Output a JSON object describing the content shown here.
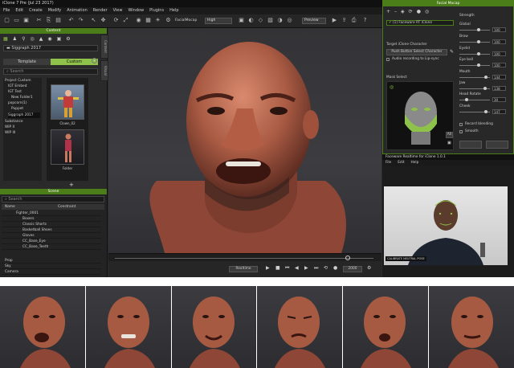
{
  "app": {
    "title": "iClone 7 Pre (Jul 23 2017)"
  },
  "menu": [
    "File",
    "Edit",
    "Create",
    "Modify",
    "Animation",
    "Render",
    "View",
    "Window",
    "Plugins",
    "Help"
  ],
  "toolbar": {
    "preset_label": "FacialMocap",
    "quality": "High",
    "preview": "Preview"
  },
  "content": {
    "title": "Content",
    "path": "Siggraph 2017",
    "tabs": [
      "Template",
      "Custom"
    ],
    "search_placeholder": "Search",
    "tree": [
      "Project Custom",
      "IGT Embed",
      "IGT Test",
      "New Folder1",
      "popcorn(1)",
      "Puppet",
      "Siggraph 2017",
      "Substance",
      "WIP II",
      "WIP III"
    ],
    "items": [
      {
        "label": "Clown_02"
      },
      {
        "label": "Folder"
      }
    ],
    "side_tabs": [
      "Content",
      "Visual"
    ]
  },
  "scene": {
    "title": "Scene",
    "search_placeholder": "Search",
    "columns": [
      "Name",
      "Constraint"
    ],
    "rows": [
      "Fighter_0001",
      "Boxers",
      "Classic Shorts",
      "Basketball Shoes",
      "Gloves",
      "CC_Base_Eye",
      "CC_Base_Teeth"
    ],
    "footer_rows": [
      "Prop",
      "Sky",
      "Camera"
    ]
  },
  "playback": {
    "realtime": "Realtime",
    "frame": "2000"
  },
  "facial_mocap": {
    "title": "Facial Mocap",
    "device_entry": "(1) Faceware RT iClone",
    "target_label": "Target iClone Character",
    "pick_button": "Push Button Select Character",
    "audio_label": "Audio recording to Lip-sync",
    "mask_label": "Mask Select",
    "all_button": "All",
    "strength_title": "Strength",
    "sliders": [
      {
        "label": "Global",
        "value": "100",
        "level": 0.65
      },
      {
        "label": "Brow",
        "value": "100",
        "level": 0.65
      },
      {
        "label": "Eyelid",
        "value": "100",
        "level": 0.65
      },
      {
        "label": "Eye ball",
        "value": "100",
        "level": 0.65
      },
      {
        "label": "Mouth",
        "value": "144",
        "level": 0.9
      },
      {
        "label": "Jaw",
        "value": "138",
        "level": 0.87
      },
      {
        "label": "Head Rotate",
        "value": "30",
        "level": 0.2
      },
      {
        "label": "Cheek",
        "value": "147",
        "level": 0.92
      }
    ],
    "checkboxes": [
      "Record blending",
      "Smooth"
    ]
  },
  "realtime_app": {
    "title": "Faceware Realtime for iClone 1.0.1",
    "menu": [
      "File",
      "Edit",
      "Help"
    ],
    "calibrate": "CALIBRATE NEUTRAL POSE"
  },
  "colors": {
    "accent": "#4b7d18",
    "skin": "#b9664e"
  }
}
